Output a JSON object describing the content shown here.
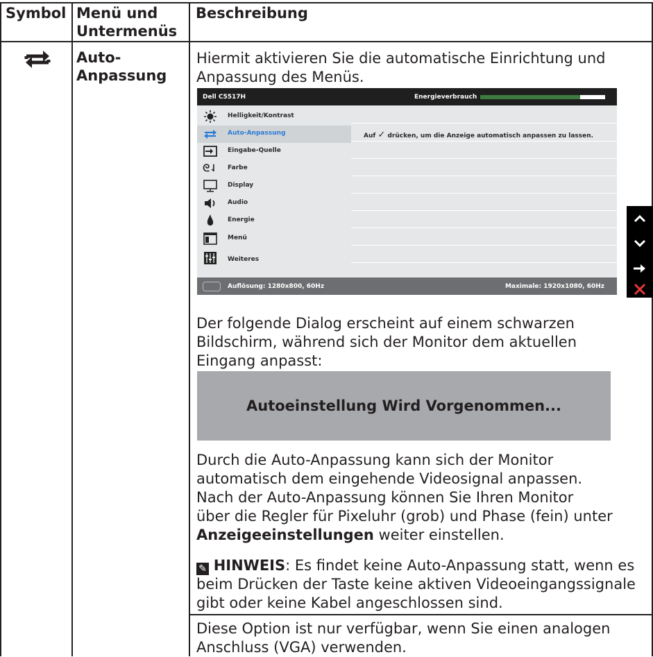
{
  "table": {
    "headers": {
      "symbol": "Symbol",
      "menu": "Menü und",
      "menu2": "Untermenüs",
      "description": "Beschreibung"
    },
    "row": {
      "name1": "Auto-",
      "name2": "Anpassung",
      "symbol_icon": "auto-adjust-arrows-icon"
    }
  },
  "content": {
    "intro_line1": "Hiermit aktivieren Sie die automatische Einrichtung und",
    "intro_line2": "Anpassung des Menüs.",
    "dialog_intro_1": "Der folgende Dialog erscheint auf einem schwarzen",
    "dialog_intro_2": "Bildschirm, während sich der Monitor dem aktuellen",
    "dialog_intro_3": "Eingang anpasst:",
    "dialog_text": "Autoeinstellung Wird Vorgenommen...",
    "para_1": "Durch die Auto-Anpassung kann sich der Monitor",
    "para_2": "automatisch dem eingehende Videosignal anpassen.",
    "para_3": "Nach der Auto-Anpassung können Sie Ihren Monitor",
    "para_4": "über die Regler für Pixeluhr (grob) und Phase (fein) unter",
    "para_5_bold": "Anzeigeeinstellungen",
    "para_5_rest": " weiter einstellen.",
    "note_label": "HINWEIS",
    "note_1": ": Es findet keine Auto-Anpassung statt, wenn es",
    "note_2": "beim Drücken der Taste keine aktiven Videoeingangssignale",
    "note_3": "gibt oder keine Kabel angeschlossen sind.",
    "option_1": "Diese Option ist nur verfügbar, wenn Sie einen analogen",
    "option_2": "Anschluss (VGA) verwenden."
  },
  "osd": {
    "model": "Dell C5517H",
    "energy_label": "Energieverbrauch",
    "menu_items": [
      {
        "label": "Helligkeit/Kontrast",
        "icon": "brightness-icon"
      },
      {
        "label": "Auto-Anpassung",
        "icon": "auto-adjust-icon",
        "selected": true
      },
      {
        "label": "Eingabe-Quelle",
        "icon": "input-source-icon"
      },
      {
        "label": "Farbe",
        "icon": "color-icon"
      },
      {
        "label": "Display",
        "icon": "display-icon"
      },
      {
        "label": "Audio",
        "icon": "speaker-icon"
      },
      {
        "label": "Energie",
        "icon": "energy-icon"
      },
      {
        "label": "Menü",
        "icon": "menu-icon"
      },
      {
        "label": "Weiteres",
        "icon": "others-icon"
      }
    ],
    "auto_hint_pre": "Auf",
    "auto_hint_post": "drücken, um die Anzeige automatisch anpassen zu lassen.",
    "resolution": "Auflösung: 1280x800, 60Hz",
    "max_resolution": "Maximale: 1920x1080, 60Hz",
    "nav_buttons": [
      "up-arrow-icon",
      "down-arrow-icon",
      "right-arrow-icon",
      "close-icon"
    ],
    "colors": {
      "accent": "#2b7bd6",
      "energy_bar": "#3d7a3f"
    }
  }
}
